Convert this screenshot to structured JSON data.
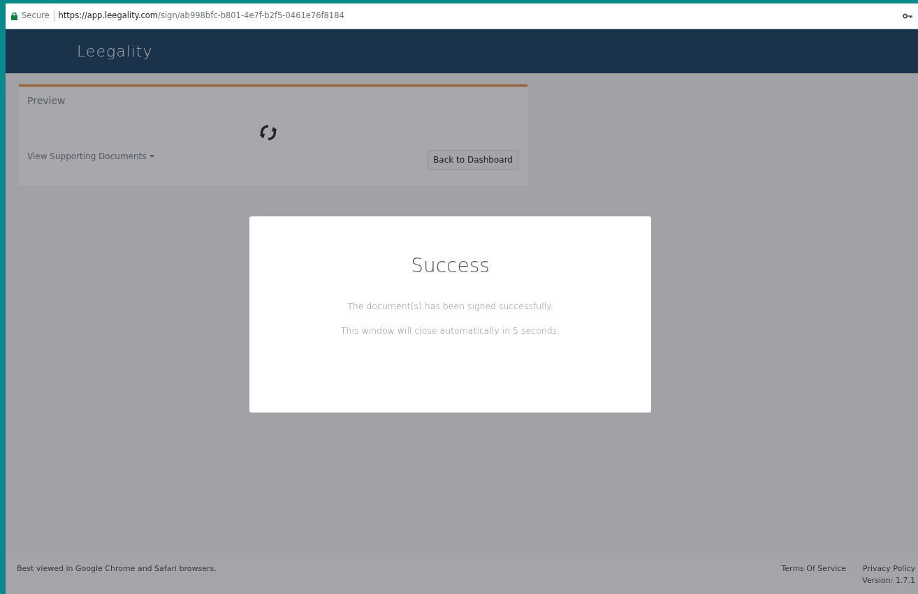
{
  "browser": {
    "security_label": "Secure",
    "url_host": "https://app.leegality.com",
    "url_path": "/sign/ab998bfc-b801-4e7f-b2f5-0461e76f8184"
  },
  "navbar": {
    "brand": "Leegality"
  },
  "document_card": {
    "title": "Preview",
    "dropdown": "View Supporting Documents",
    "button": "Back to Dashboard",
    "loading": true
  },
  "modal": {
    "title": "Success",
    "messages": [
      "The document(s) has been signed successfully.",
      "This window will close automatically in 5 seconds."
    ]
  },
  "footer": {
    "note": "Best viewed in Google Chrome and Safari browsers.",
    "links": [
      "Terms Of Service",
      "Privacy Policy"
    ],
    "version": "Version: 1.7.1"
  }
}
